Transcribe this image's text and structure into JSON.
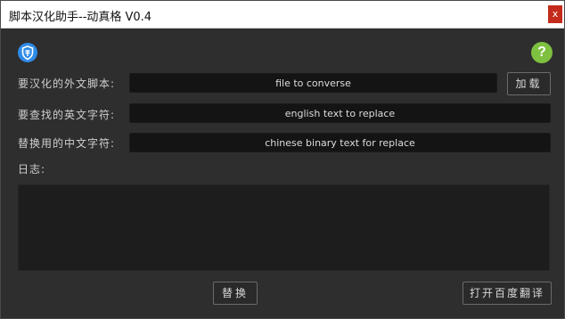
{
  "window": {
    "title": "脚本汉化助手--动真格 V0.4",
    "close_label": "x"
  },
  "icons": {
    "left": "shield-icon",
    "right": "help-icon",
    "help_glyph": "?"
  },
  "form": {
    "script_label": "要汉化的外文脚本:",
    "script_placeholder": "file to converse",
    "load_button": "加载",
    "find_label": "要查找的英文字符:",
    "find_placeholder": "english text to replace",
    "replace_label": "替换用的中文字符:",
    "replace_placeholder": "chinese binary text for replace"
  },
  "log": {
    "label": "日志:",
    "content": ""
  },
  "actions": {
    "replace_button": "替换",
    "translate_button": "打开百度翻译"
  },
  "colors": {
    "shield": "#2f8be8",
    "help": "#7ec040",
    "close": "#c42b1c"
  }
}
